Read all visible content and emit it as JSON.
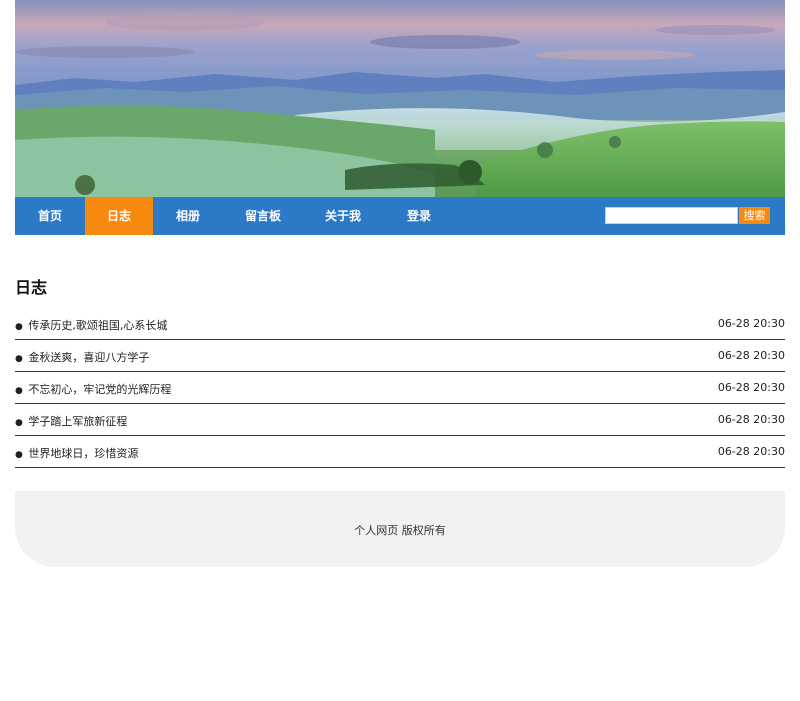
{
  "colors": {
    "nav_background": "#2b79c7",
    "nav_active": "#f7890e",
    "footer_background": "#f2f2f2",
    "divider": "#333333"
  },
  "banner": {
    "image_subject": "landscape-photo"
  },
  "nav": {
    "items": [
      {
        "label": "首页"
      },
      {
        "label": "日志",
        "active": true
      },
      {
        "label": "相册"
      },
      {
        "label": "留言板"
      },
      {
        "label": "关于我"
      },
      {
        "label": "登录"
      }
    ],
    "search": {
      "value": "",
      "placeholder": "",
      "button_label": "搜索"
    }
  },
  "main": {
    "title": "日志",
    "posts": [
      {
        "bullet": "●",
        "title": "传承历史,歌颂祖国,心系长城",
        "date": "06-28 20:30"
      },
      {
        "bullet": "●",
        "title": "金秋送爽，喜迎八方学子",
        "date": "06-28 20:30"
      },
      {
        "bullet": "●",
        "title": "不忘初心，牢记党的光辉历程",
        "date": "06-28 20:30"
      },
      {
        "bullet": "●",
        "title": "学子踏上军旅新征程",
        "date": "06-28 20:30"
      },
      {
        "bullet": "●",
        "title": "世界地球日，珍惜资源",
        "date": "06-28 20:30"
      }
    ]
  },
  "footer": {
    "text": "个人网页 版权所有"
  }
}
